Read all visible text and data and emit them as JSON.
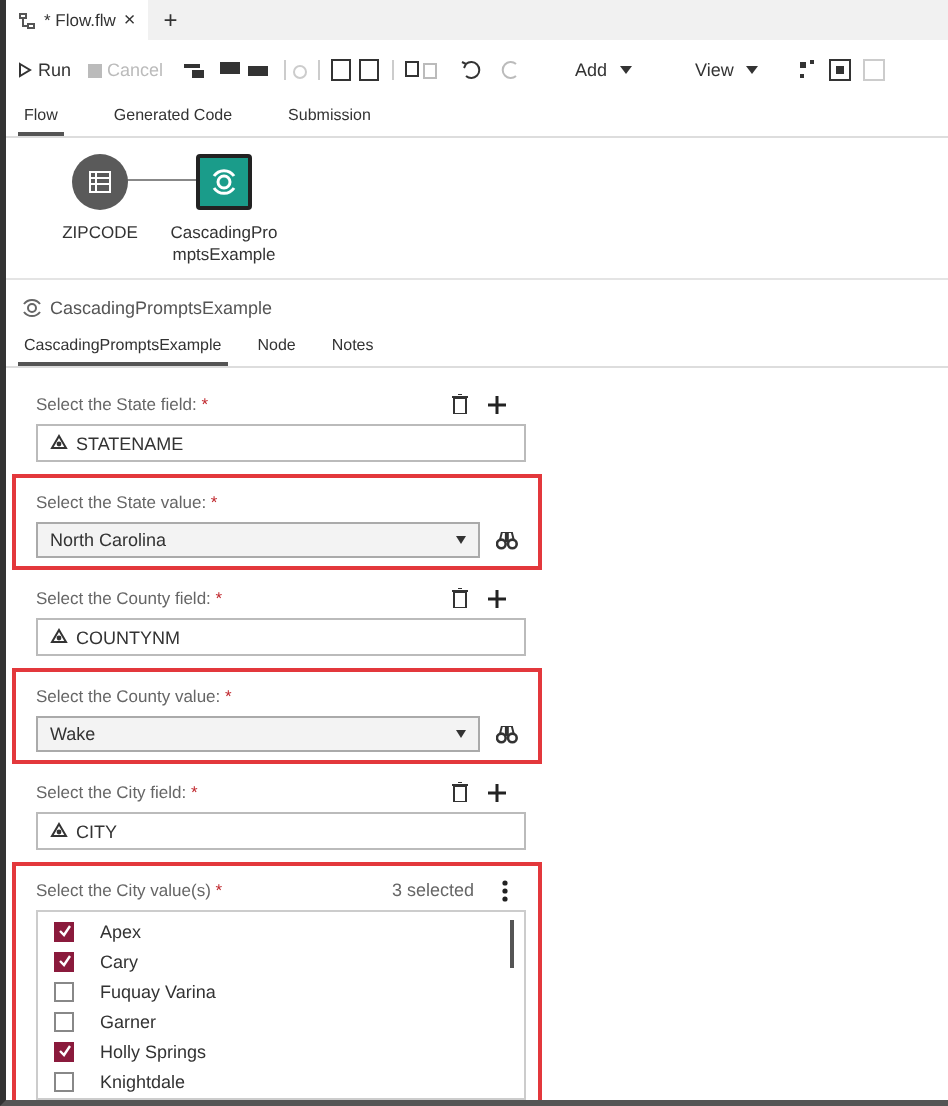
{
  "file_tab": {
    "title": "* Flow.flw",
    "close": "×",
    "add": "+"
  },
  "toolbar": {
    "buttons": [
      {
        "label": "Run",
        "disabled": false
      },
      {
        "label": "Cancel",
        "disabled": true
      }
    ],
    "menus": [
      "Add",
      "View"
    ]
  },
  "view_tabs": [
    {
      "label": "Flow",
      "selected": true
    },
    {
      "label": "Generated Code",
      "selected": false
    },
    {
      "label": "Submission",
      "selected": false
    }
  ],
  "nodes": [
    {
      "kind": "table",
      "label": "ZIPCODE"
    },
    {
      "kind": "step",
      "label": "CascadingPro mptsExample",
      "selected": true
    }
  ],
  "panel_title": "CascadingPromptsExample",
  "panel_tabs": [
    {
      "label": "CascadingPromptsExample",
      "selected": true
    },
    {
      "label": "Node",
      "selected": false
    },
    {
      "label": "Notes",
      "selected": false
    }
  ],
  "form": [
    {
      "kind": "column",
      "label": "Select the State field:",
      "mark": "*",
      "value": "STATENAME",
      "highlighted": false
    },
    {
      "kind": "select",
      "label": "Select the State value:",
      "mark": "*",
      "value": "North Carolina",
      "highlighted": true
    },
    {
      "kind": "column",
      "label": "Select the County field:",
      "mark": "*",
      "value": "COUNTYNM",
      "highlighted": false
    },
    {
      "kind": "select",
      "label": "Select the County value:",
      "mark": "*",
      "value": "Wake",
      "highlighted": true
    },
    {
      "kind": "column",
      "label": "Select the City field:",
      "mark": "*",
      "value": "CITY",
      "highlighted": false
    },
    {
      "kind": "multiselect",
      "label": "Select the City value(s)",
      "mark": "*",
      "count": "3 selected",
      "highlighted": true,
      "options": [
        {
          "label": "Apex",
          "checked": true
        },
        {
          "label": "Cary",
          "checked": true
        },
        {
          "label": "Fuquay Varina",
          "checked": false
        },
        {
          "label": "Garner",
          "checked": false
        },
        {
          "label": "Holly Springs",
          "checked": true
        },
        {
          "label": "Knightdale",
          "checked": false
        }
      ]
    }
  ]
}
